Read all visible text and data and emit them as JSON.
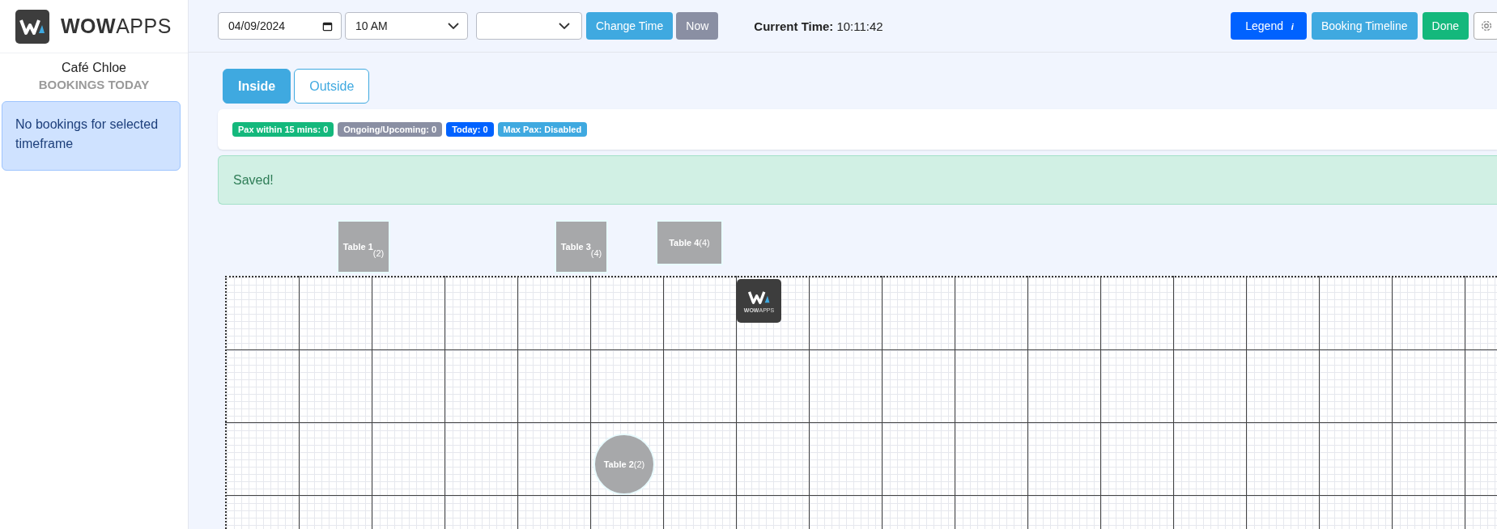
{
  "sidebar": {
    "brand": "**WOW**APPS",
    "venue": "Café Chloe",
    "heading": "BOOKINGS TODAY",
    "notice": "No bookings for selected timeframe"
  },
  "toolbar": {
    "date": "04/09/2024",
    "hour": "10 AM",
    "change_button": "Change Time",
    "now_button": "Now",
    "time_label": "Current Time:",
    "time_value": "10:11:42",
    "legend_button": "Legend",
    "legend_mark": "i",
    "timeline_button": "Booking Timeline",
    "done_button": "Done"
  },
  "tabs": [
    {
      "label": "Inside",
      "selected": true
    },
    {
      "label": "Outside",
      "selected": false
    }
  ],
  "badges": [
    {
      "text": "Pax within 15 mins: 0",
      "color": "#14b87c"
    },
    {
      "text": "Ongoing/Upcoming: 0",
      "color": "#8a8fa3"
    },
    {
      "text": "Today: 0",
      "color": "#0062ff"
    },
    {
      "text": "Max Pax: Disabled",
      "color": "#3fa9e0"
    }
  ],
  "alert": "Saved!",
  "floor": {
    "tables": [
      {
        "kind": "square",
        "name": "Table 1",
        "pax": "(2)"
      },
      {
        "kind": "square",
        "name": "Table 3",
        "pax": "(4)"
      },
      {
        "kind": "wide",
        "name": "Table 4",
        "pax": "(4)"
      },
      {
        "kind": "round",
        "name": "Table 2",
        "pax": "(2)"
      }
    ],
    "logo_text": "**WOW**APPS"
  }
}
